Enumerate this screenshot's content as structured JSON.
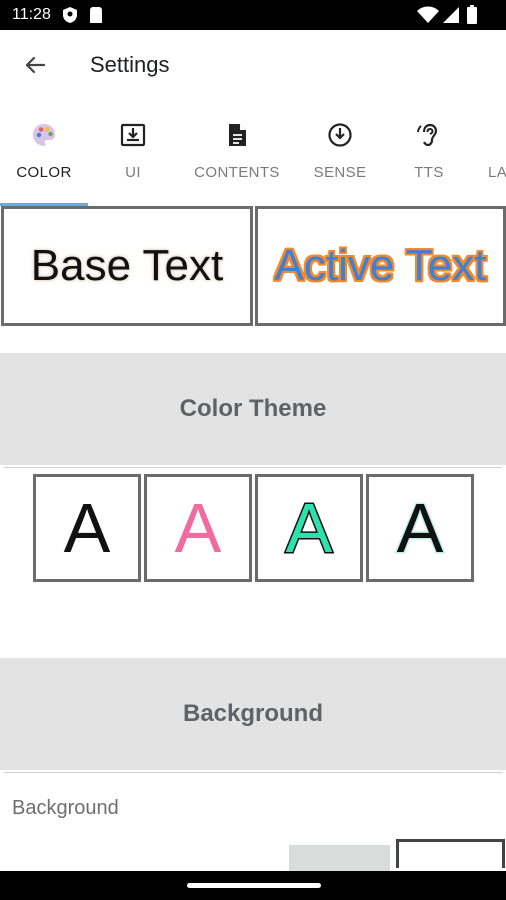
{
  "status_bar": {
    "time": "11:28",
    "icons": [
      "shield-icon",
      "sim-card-icon",
      "wifi-icon",
      "cell-signal-icon",
      "battery-icon"
    ]
  },
  "app_bar": {
    "back_icon": "arrow-left-icon",
    "title": "Settings"
  },
  "tabs": [
    {
      "label": "COLOR",
      "icon": "palette-icon",
      "active": true
    },
    {
      "label": "UI",
      "icon": "download-box-icon",
      "active": false
    },
    {
      "label": "CONTENTS",
      "icon": "document-icon",
      "active": false
    },
    {
      "label": "SENSE",
      "icon": "circle-down-arrow-icon",
      "active": false
    },
    {
      "label": "TTS",
      "icon": "hearing-icon",
      "active": false
    },
    {
      "label": "LA",
      "icon": "",
      "active": false
    }
  ],
  "preview": {
    "base_text": "Base Text",
    "active_text": "Active Text"
  },
  "sections": {
    "color_theme": "Color Theme",
    "background": "Background"
  },
  "color_themes": [
    {
      "letter": "A",
      "fill": "#111111",
      "stroke": "none"
    },
    {
      "letter": "A",
      "fill": "#f06ba0",
      "stroke": "#f3a3c6"
    },
    {
      "letter": "A",
      "fill": "#2fe0ad",
      "stroke": "#111111"
    },
    {
      "letter": "A",
      "fill": "#111111",
      "stroke": "#bfeee5"
    }
  ],
  "background": {
    "label": "Background"
  },
  "colors": {
    "accent": "#6fa8dc",
    "section_bg": "#e3e3e3",
    "border": "#6b6b6b"
  }
}
